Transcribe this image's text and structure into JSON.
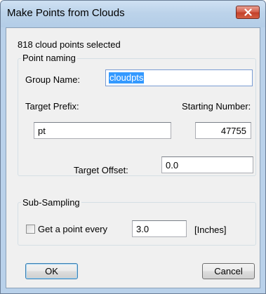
{
  "window": {
    "title": "Make Points from Clouds",
    "close_glyph": "✕"
  },
  "status": {
    "selected_text": "818 cloud points selected"
  },
  "point_naming": {
    "legend": "Point naming",
    "group_name_label": "Group Name:",
    "group_name_value": "cloudpts",
    "target_prefix_label": "Target Prefix:",
    "target_prefix_value": "pt",
    "starting_number_label": "Starting Number:",
    "starting_number_value": "47755",
    "target_offset_label": "Target Offset:",
    "target_offset_value": "0.0"
  },
  "sub_sampling": {
    "legend": "Sub-Sampling",
    "checkbox_label": "Get a point every",
    "checked": false,
    "interval_value": "3.0",
    "units_label": "[Inches]"
  },
  "buttons": {
    "ok_label": "OK",
    "cancel_label": "Cancel"
  },
  "colors": {
    "frame": "#b9d1ea",
    "client": "#f0f0f0",
    "selection": "#3399ff",
    "close_button": "#c7402a"
  }
}
